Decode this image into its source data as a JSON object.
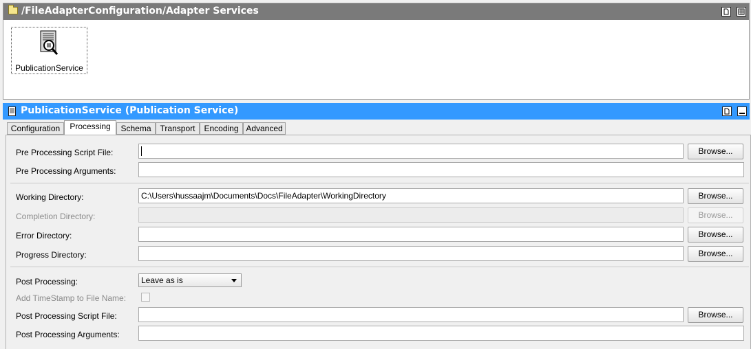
{
  "top_panel": {
    "title": "/FileAdapterConfiguration/Adapter Services",
    "service_tile_label": "PublicationService"
  },
  "bottom_panel": {
    "title": "PublicationService (Publication Service)"
  },
  "tabs": [
    "Configuration",
    "Processing",
    "Schema",
    "Transport",
    "Encoding",
    "Advanced"
  ],
  "active_tab": "Processing",
  "form": {
    "pre_script_label": "Pre Processing Script File:",
    "pre_script_value": "",
    "pre_args_label": "Pre Processing Arguments:",
    "pre_args_value": "",
    "working_dir_label": "Working Directory:",
    "working_dir_value": "C:\\Users\\hussaajm\\Documents\\Docs\\FileAdapter\\WorkingDirectory",
    "completion_dir_label": "Completion Directory:",
    "completion_dir_value": "",
    "error_dir_label": "Error Directory:",
    "error_dir_value": "",
    "progress_dir_label": "Progress Directory:",
    "progress_dir_value": "",
    "post_processing_label": "Post Processing:",
    "post_processing_value": "Leave as is",
    "timestamp_label": "Add TimeStamp to File Name:",
    "post_script_label": "Post Processing Script File:",
    "post_script_value": "",
    "post_args_label": "Post Processing Arguments:",
    "post_args_value": ""
  },
  "browse_label": "Browse..."
}
